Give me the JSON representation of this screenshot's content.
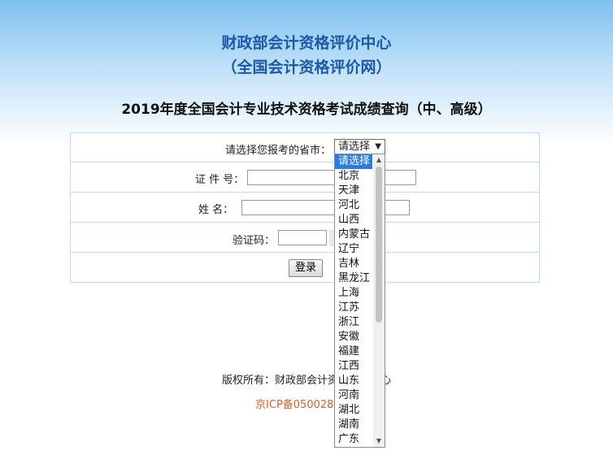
{
  "header": {
    "title_line1": "财政部会计资格评价中心",
    "title_line2": "（全国会计资格评价网）"
  },
  "query_title": "2019年度全国会计专业技术资格考试成绩查询（中、高级）",
  "form": {
    "province_label": "请选择您报考的省市：",
    "province_selected": "请选择",
    "id_label": "证 件 号：",
    "name_label": "姓  名：",
    "captcha_label": "验证码：",
    "login_button": "登录"
  },
  "dropdown": {
    "options": [
      "请选择",
      "北京",
      "天津",
      "河北",
      "山西",
      "内蒙古",
      "辽宁",
      "吉林",
      "黑龙江",
      "上海",
      "江苏",
      "浙江",
      "安徽",
      "福建",
      "江西",
      "山东",
      "河南",
      "湖北",
      "湖南",
      "广东"
    ],
    "highlighted_index": 0
  },
  "footer": {
    "copyright": "版权所有：财政部会计资格评价中心",
    "icp": "京ICP备05002865号"
  },
  "colors": {
    "header_text": "#1a5aa8",
    "icp_text": "#d9602a",
    "highlight": "#2a7be4",
    "table_border": "#bcdcee"
  }
}
